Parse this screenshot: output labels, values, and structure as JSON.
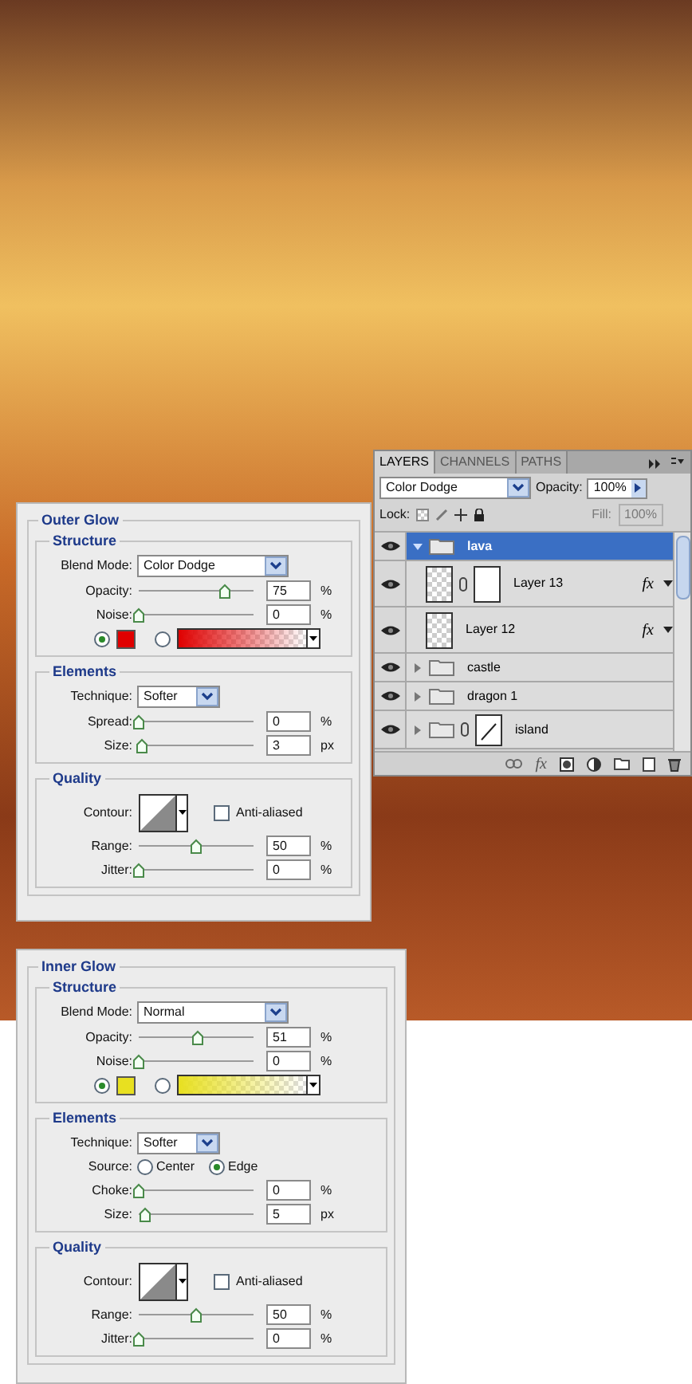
{
  "layers_panel": {
    "tabs": [
      {
        "label": "LAYERS",
        "selected": true
      },
      {
        "label": "CHANNELS",
        "selected": false
      },
      {
        "label": "PATHS",
        "selected": false
      }
    ],
    "blend_mode": "Color Dodge",
    "opacity_label": "Opacity:",
    "opacity": "100%",
    "lock_label": "Lock:",
    "fill_label": "Fill:",
    "fill": "100%",
    "layers": [
      {
        "name": "lava",
        "kind": "group",
        "selected": true,
        "expanded": true,
        "visible": true,
        "mask": false,
        "children": [
          {
            "name": "Layer 13",
            "kind": "layer",
            "selected": false,
            "visible": true,
            "mask": true,
            "mask_curve": false,
            "fx": "fx"
          },
          {
            "name": "Layer 12",
            "kind": "layer",
            "selected": false,
            "visible": true,
            "mask": false,
            "fx": "fx"
          }
        ]
      },
      {
        "name": "castle",
        "kind": "group",
        "selected": false,
        "expanded": false,
        "visible": true,
        "mask": false
      },
      {
        "name": "dragon 1",
        "kind": "group",
        "selected": false,
        "expanded": false,
        "visible": true,
        "mask": false
      },
      {
        "name": "island",
        "kind": "group",
        "selected": false,
        "expanded": false,
        "visible": true,
        "mask": true,
        "mask_curve": true
      }
    ],
    "footer_fx": "fx"
  },
  "dialogs": [
    {
      "title": "Outer Glow",
      "sections": [
        {
          "title": "Structure",
          "rows": [
            {
              "kind": "select",
              "label": "Blend Mode:",
              "value": "Color Dodge"
            },
            {
              "kind": "slider",
              "label": "Opacity:",
              "level": 0.75,
              "value": "75",
              "unit": "%"
            },
            {
              "kind": "slider",
              "label": "Noise:",
              "level": 0,
              "value": "0",
              "unit": "%"
            },
            {
              "kind": "color",
              "solid_selected": true,
              "color": "#e00000"
            }
          ]
        },
        {
          "title": "Elements",
          "rows": [
            {
              "kind": "technique",
              "label": "Technique:",
              "value": "Softer"
            },
            {
              "kind": "slider",
              "label": "Spread:",
              "level": 0,
              "value": "0",
              "unit": "%"
            },
            {
              "kind": "slider",
              "label": "Size:",
              "level": 0.03,
              "value": "3",
              "unit": "px"
            }
          ]
        },
        {
          "title": "Quality",
          "rows": [
            {
              "kind": "contour",
              "label": "Contour:",
              "checkbox_label": "Anti-aliased",
              "checked": false
            },
            {
              "kind": "slider",
              "label": "Range:",
              "level": 0.5,
              "value": "50",
              "unit": "%"
            },
            {
              "kind": "slider",
              "label": "Jitter:",
              "level": 0,
              "value": "0",
              "unit": "%"
            }
          ]
        }
      ]
    },
    {
      "title": "Inner Glow",
      "sections": [
        {
          "title": "Structure",
          "rows": [
            {
              "kind": "select",
              "label": "Blend Mode:",
              "value": "Normal"
            },
            {
              "kind": "slider",
              "label": "Opacity:",
              "level": 0.51,
              "value": "51",
              "unit": "%"
            },
            {
              "kind": "slider",
              "label": "Noise:",
              "level": 0,
              "value": "0",
              "unit": "%"
            },
            {
              "kind": "color",
              "solid_selected": true,
              "color": "#e8e020"
            }
          ]
        },
        {
          "title": "Elements",
          "rows": [
            {
              "kind": "technique",
              "label": "Technique:",
              "value": "Softer"
            },
            {
              "kind": "radio",
              "label": "Source:",
              "options": [
                {
                  "label": "Center",
                  "selected": false
                },
                {
                  "label": "Edge",
                  "selected": true
                }
              ]
            },
            {
              "kind": "slider",
              "label": "Choke:",
              "level": 0,
              "value": "0",
              "unit": "%"
            },
            {
              "kind": "slider",
              "label": "Size:",
              "level": 0.05,
              "value": "5",
              "unit": "px"
            }
          ]
        },
        {
          "title": "Quality",
          "rows": [
            {
              "kind": "contour",
              "label": "Contour:",
              "checkbox_label": "Anti-aliased",
              "checked": false
            },
            {
              "kind": "slider",
              "label": "Range:",
              "level": 0.5,
              "value": "50",
              "unit": "%"
            },
            {
              "kind": "slider",
              "label": "Jitter:",
              "level": 0,
              "value": "0",
              "unit": "%"
            }
          ]
        }
      ]
    }
  ]
}
